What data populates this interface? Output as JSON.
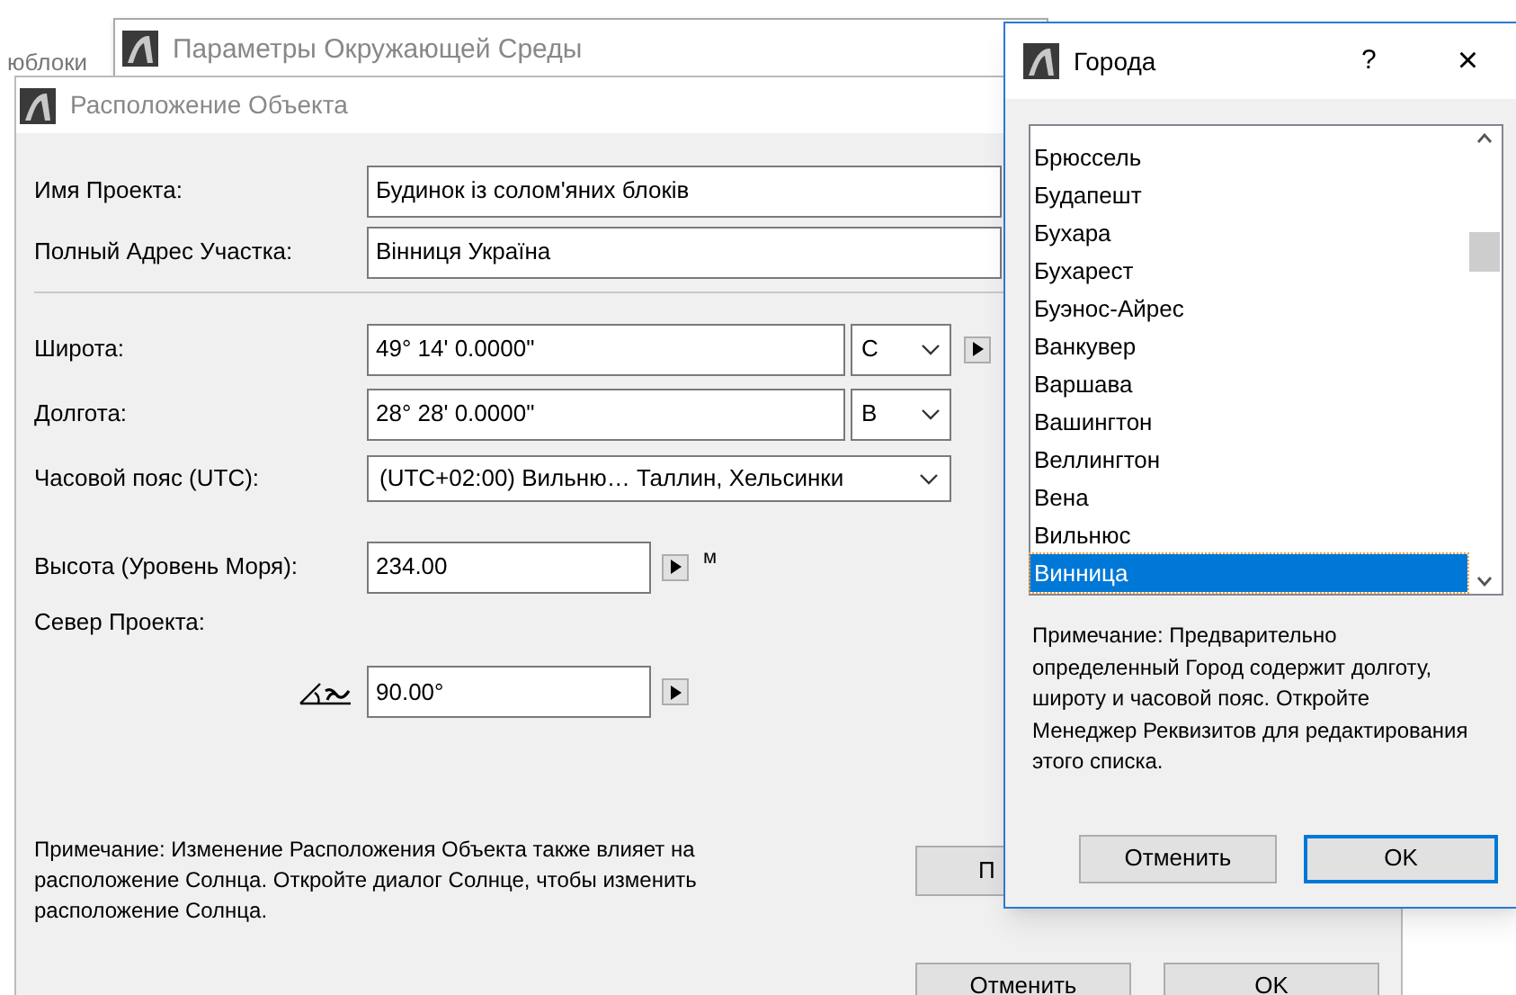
{
  "background_window": {
    "title": "Параметры Окружающей Среды",
    "partial_text": "юблоки"
  },
  "location_dialog": {
    "title": "Расположение Объекта",
    "fields": [
      {
        "label": "Имя Проекта:",
        "value": "Будинок із солом'яних блоків"
      },
      {
        "label": "Полный Адрес Участка:",
        "value": "Вінниця Україна"
      }
    ],
    "latitude": {
      "label": "Широта:",
      "value": "49° 14' 0.0000\"",
      "direction": "С"
    },
    "longitude": {
      "label": "Долгота:",
      "value": "28° 28' 0.0000\"",
      "direction": "В"
    },
    "timezone": {
      "label": "Часовой пояс (UTC):",
      "value": "(UTC+02:00) Вильню… Таллин, Хельсинки"
    },
    "altitude": {
      "label": "Высота (Уровень Моря):",
      "value": "234.00",
      "unit": "м"
    },
    "project_north": {
      "label": "Север Проекта:",
      "value": "90.00°"
    },
    "note": "Примечание: Изменение Расположения Объекта также влияет на расположение Солнца. Откройте диалог Солнце, чтобы изменить расположение Солнца.",
    "partial_button": "П",
    "buttons": [
      {
        "label": "Отменить",
        "default": false
      },
      {
        "label": "OK",
        "default": false
      }
    ]
  },
  "cities_dialog": {
    "title": "Города",
    "help": "?",
    "close": "×",
    "cities": [
      {
        "name": "Брюссель",
        "selected": false
      },
      {
        "name": "Будапешт",
        "selected": false
      },
      {
        "name": "Бухара",
        "selected": false
      },
      {
        "name": "Бухарест",
        "selected": false
      },
      {
        "name": "Буэнос-Айрес",
        "selected": false
      },
      {
        "name": "Ванкувер",
        "selected": false
      },
      {
        "name": "Варшава",
        "selected": false
      },
      {
        "name": "Вашингтон",
        "selected": false
      },
      {
        "name": "Веллингтон",
        "selected": false
      },
      {
        "name": "Вена",
        "selected": false
      },
      {
        "name": "Вильнюс",
        "selected": false
      },
      {
        "name": "Винница",
        "selected": true
      }
    ],
    "note": "Примечание: Предварительно определенный Город содержит долготу, широту и часовой пояс. Откройте Менеджер Реквизитов для редактирования этого списка.",
    "buttons": [
      {
        "label": "Отменить",
        "default": false
      },
      {
        "label": "OK",
        "default": true
      }
    ]
  }
}
